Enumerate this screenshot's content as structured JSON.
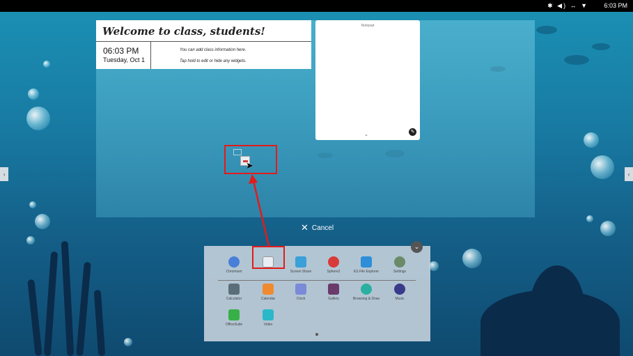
{
  "status_bar": {
    "icons": "✱ ◀) ↔ ▼",
    "time": "6:03 PM"
  },
  "welcome_widget": {
    "title": "Welcome to class, students!",
    "time": "06:03 PM",
    "date": "Tuesday, Oct 1",
    "info_line1": "You can add class information here.",
    "info_line2": "Tap hold to edit or hide any widgets."
  },
  "notepad_widget": {
    "title": "Notepad",
    "chevron": "⌄",
    "edit_icon": "✎"
  },
  "cancel": {
    "icon": "✕",
    "label": "Cancel"
  },
  "drawer": {
    "collapse_icon": "⌄",
    "row1": [
      {
        "label": "Chromium",
        "icon": "chromium-icon",
        "color": "#4a7fd8"
      },
      {
        "label": "",
        "icon": "whiteboard-icon",
        "color": "#e8eef3"
      },
      {
        "label": "Screen Share",
        "icon": "screen-share-icon",
        "color": "#3aa0d8"
      },
      {
        "label": "Sphere2",
        "icon": "sphere2-icon",
        "color": "#d83a3a"
      },
      {
        "label": "ES File Explorer",
        "icon": "es-file-explorer-icon",
        "color": "#2e8fd8"
      },
      {
        "label": "Settings",
        "icon": "settings-icon",
        "color": "#6a8a6a"
      }
    ],
    "row2": [
      {
        "label": "Calculator",
        "icon": "calculator-icon",
        "color": "#5a6e7a"
      },
      {
        "label": "Calendar",
        "icon": "calendar-icon",
        "color": "#f08a30"
      },
      {
        "label": "Clock",
        "icon": "clock-icon",
        "color": "#7a8ad8"
      },
      {
        "label": "Gallery",
        "icon": "gallery-icon",
        "color": "#6a3a6a"
      },
      {
        "label": "Browsing & Draw",
        "icon": "browsing-draw-icon",
        "color": "#2ab0a0"
      },
      {
        "label": "Music",
        "icon": "music-icon",
        "color": "#3a3a8a"
      }
    ],
    "row3": [
      {
        "label": "OfficeSuite",
        "icon": "officesuite-icon",
        "color": "#38b048"
      },
      {
        "label": "Video",
        "icon": "video-icon",
        "color": "#2ab8c8"
      }
    ]
  },
  "edge_arrows": {
    "left": "›",
    "right": "‹"
  }
}
